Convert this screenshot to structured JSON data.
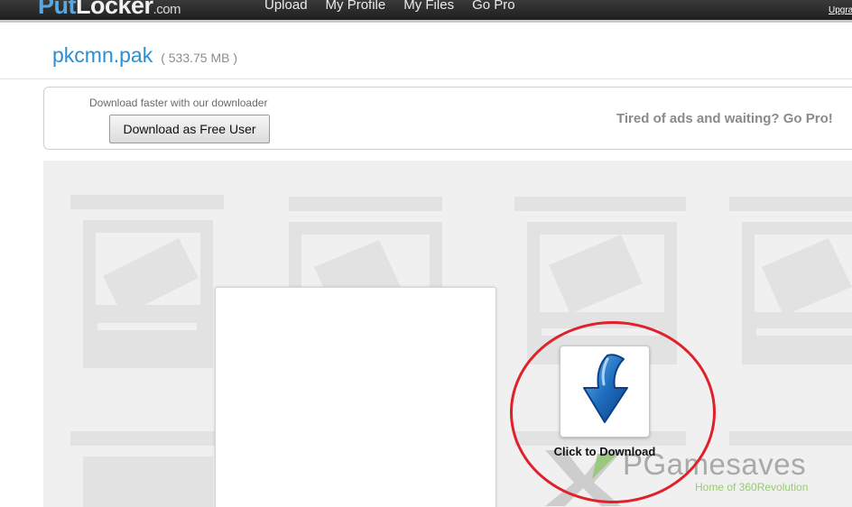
{
  "header": {
    "logo": {
      "put": "Put",
      "locker": "Locker",
      "com": ".com"
    },
    "nav": [
      {
        "label": "Upload"
      },
      {
        "label": "My Profile"
      },
      {
        "label": "My Files"
      },
      {
        "label": "Go Pro"
      }
    ],
    "upgrade_label": "Upgrade"
  },
  "file": {
    "name": "pkcmn.pak",
    "size": "( 533.75 MB )"
  },
  "download_box": {
    "caption": "Download faster with our downloader",
    "free_user_button": "Download as Free User",
    "gopro_text": "Tired of ads and waiting? Go Pro!"
  },
  "player": {
    "click_to_download": "Click to Download"
  },
  "watermark": {
    "brand": "PGamesaves",
    "tagline": "Home of 360Revolution"
  },
  "colors": {
    "accent_blue": "#2a8fd0",
    "highlight_ring": "#e0202a",
    "download_arrow": "#1f6fc0"
  }
}
